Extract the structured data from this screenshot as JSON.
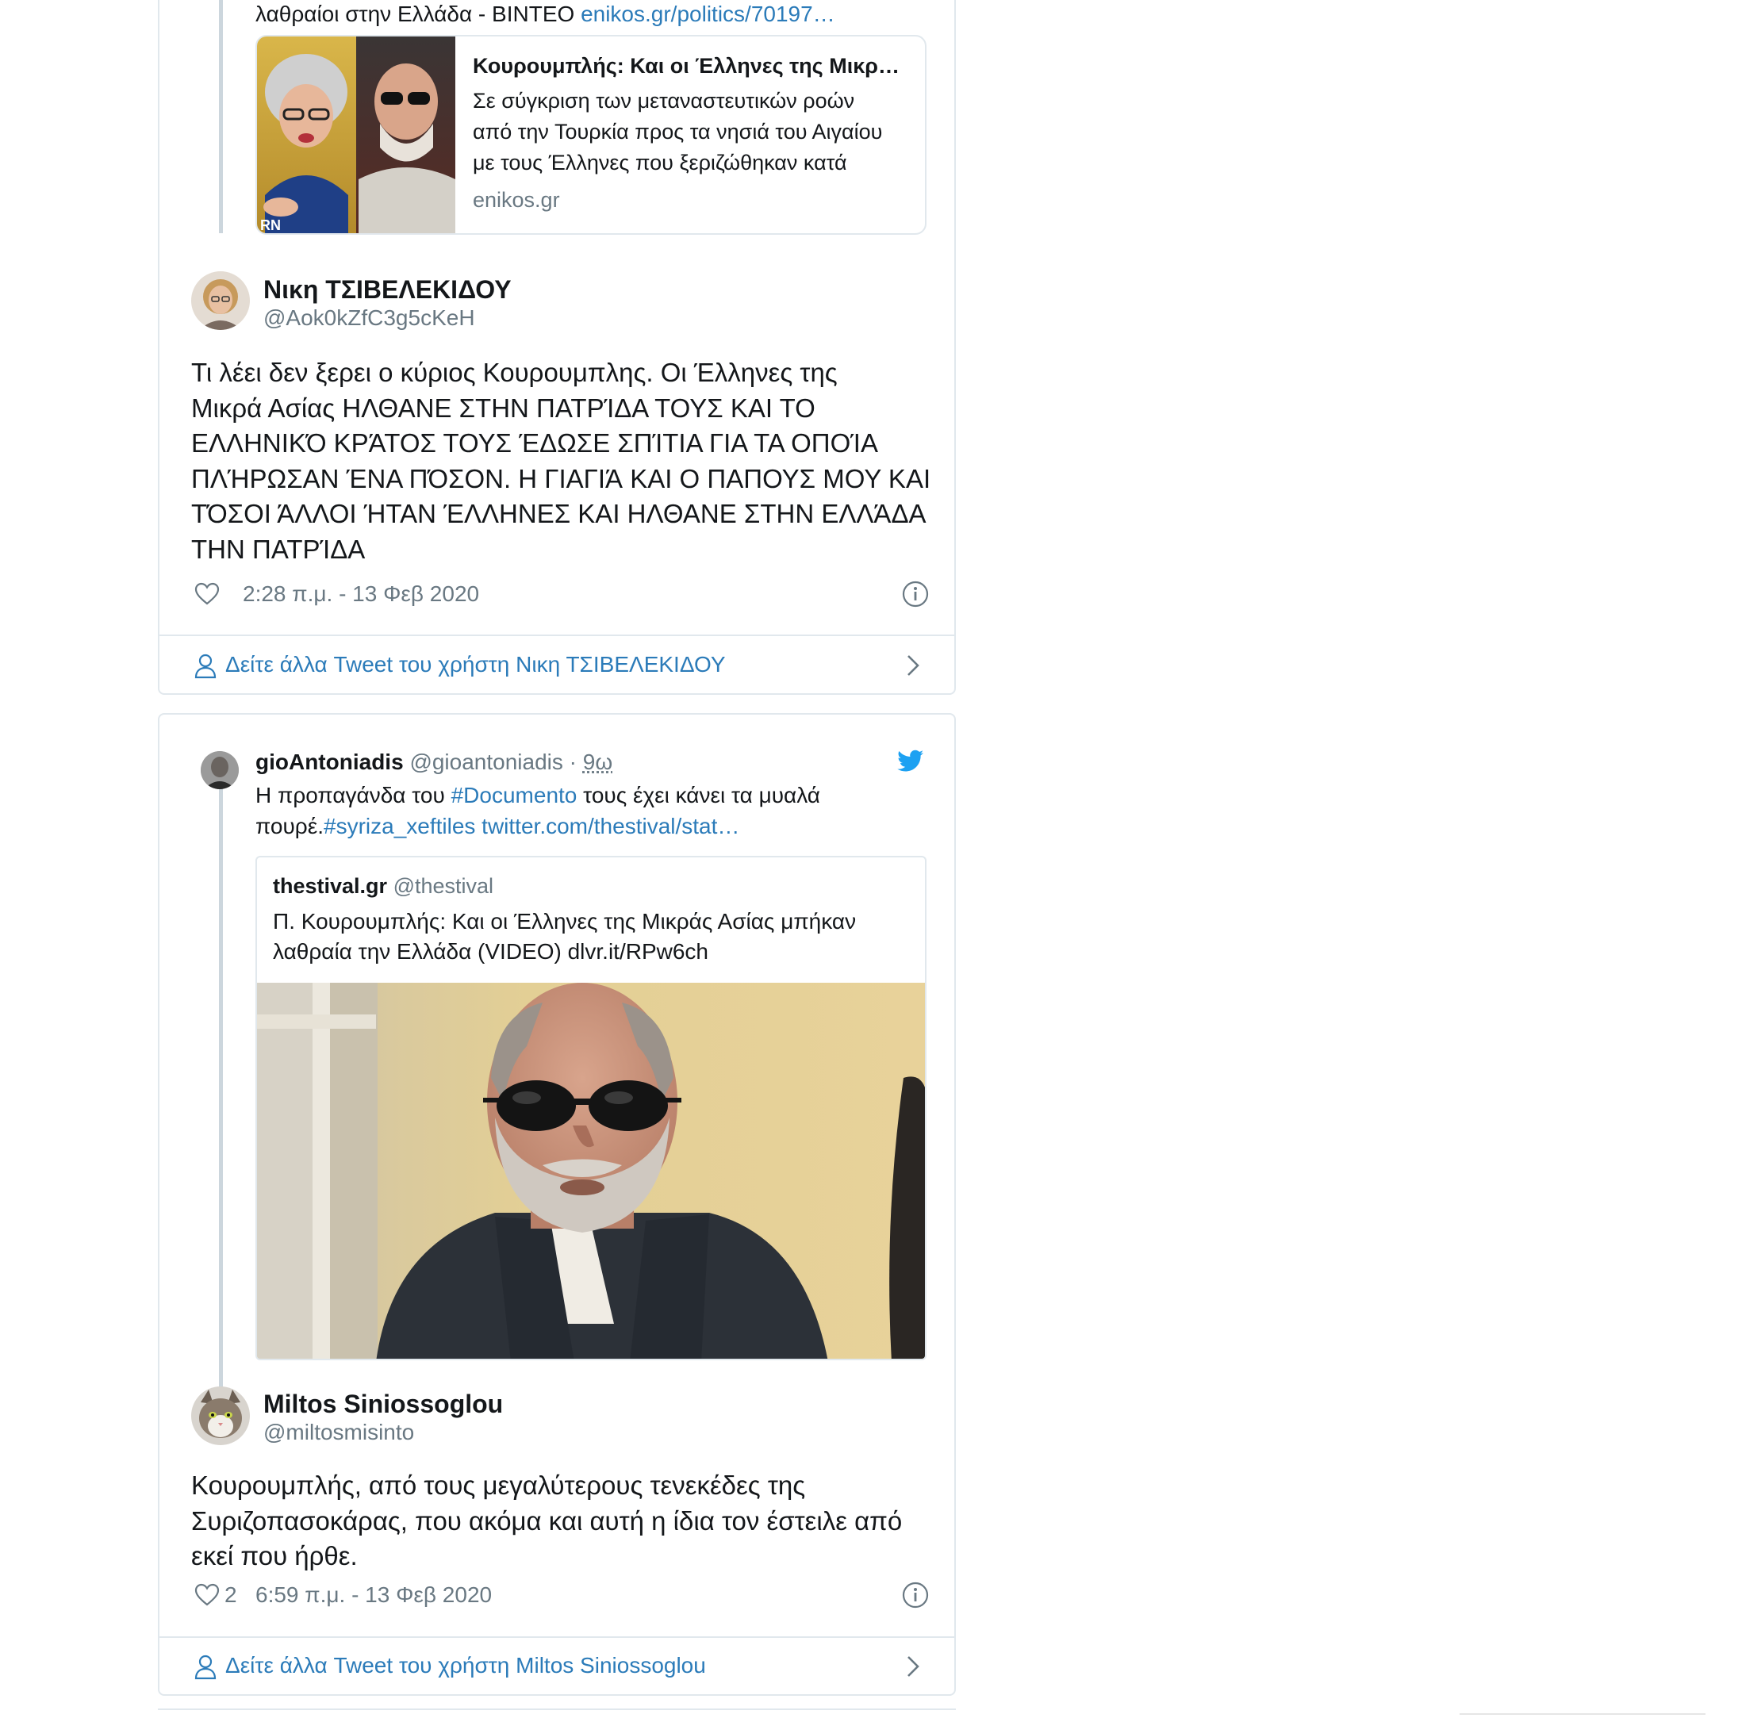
{
  "card1": {
    "quoted_text_line": "λαθραίοι στην Ελλάδα - ΒΙΝΤΕΟ",
    "quoted_link": "enikos.gr/politics/70197…",
    "link_card": {
      "title": "Κουρουμπλής: Και οι Έλληνες της Μικρ…",
      "description_lines": [
        "Σε σύγκριση των μεταναστευτικών ροών",
        "από την Τουρκία προς τα νησιά του Αιγαίου",
        "με τους Έλληνες που ξεριζώθηκαν κατά"
      ],
      "domain": "enikos.gr",
      "thumb_overlay_text": "RN"
    },
    "author": {
      "name": "Νικη ΤΣΙΒΕΛΕΚΙΔΟΥ",
      "handle": "@Aok0kZfC3g5cKeH"
    },
    "body_lines": [
      "Τι λέει δεν ξερει ο κύριος Κουρουμπλης. Οι Έλληνες της",
      "Μικρά Ασίας ΗΛΘΑΝΕ ΣΤΗΝ ΠΑΤΡΊΔΑ ΤΟΥΣ ΚΑΙ ΤΟ",
      "ΕΛΛΗΝΙΚΌ ΚΡΆΤΟΣ ΤΟΥΣ ΈΔΩΣΕ ΣΠΊΤΙΑ ΓΙΑ ΤΑ ΟΠΟΊΑ",
      "ΠΛΉΡΩΣΑΝ ΈΝΑ ΠΌΣΟΝ. Η ΓΙΑΓΙΆ ΚΑΙ Ο ΠΑΠΟΥΣ ΜΟΥ ΚΑΙ",
      "ΤΌΣΟΙ ΆΛΛΟΙ ΉΤΑΝ ΈΛΛΗΝΕΣ ΚΑΙ ΗΛΘΑΝΕ ΣΤΗΝ ΕΛΛΆΔΑ",
      "ΤΗΝ ΠΑΤΡΊΔΑ"
    ],
    "like_count": "",
    "timestamp": "2:28 π.μ. - 13 Φεβ 2020",
    "more_tweets": "Δείτε άλλα Tweet του χρήστη Νικη ΤΣΙΒΕΛΕΚΙΔΟΥ"
  },
  "card2": {
    "parent": {
      "name": "gioAntoniadis",
      "handle": "@gioantoniadis",
      "separator": "·",
      "time": "9ω",
      "text_part1": "Η προπαγάνδα του ",
      "hashtag1": "#Documento",
      "text_part2": " τους έχει κάνει τα μυαλά",
      "text_part3": "πουρέ.",
      "hashtag2": "#syriza_xeftiles",
      "link": " twitter.com/thestival/stat…"
    },
    "quoted": {
      "name": "thestival.gr",
      "handle": "@thestival",
      "line1": "Π. Κουρουμπλής: Και οι Έλληνες της Μικράς Ασίας μπήκαν",
      "line2": "λαθραία την Ελλάδα (VIDEO) dlvr.it/RPw6ch"
    },
    "author": {
      "name": "Miltos Siniossoglou",
      "handle": "@miltosmisinto"
    },
    "body_lines": [
      "Κουρουμπλής, από τους μεγαλύτερους τενεκέδες της",
      "Συριζοπασοκάρας, που ακόμα και αυτή η ίδια τον έστειλε από",
      "εκεί που ήρθε."
    ],
    "like_count": "2",
    "timestamp": "6:59 π.μ. - 13 Φεβ 2020",
    "more_tweets": "Δείτε άλλα Tweet του χρήστη Miltos Siniossoglou"
  },
  "colors": {
    "link": "#2b7bb9",
    "muted": "#697882",
    "border": "#e1e8ed",
    "twitter_blue": "#1da1f2"
  }
}
